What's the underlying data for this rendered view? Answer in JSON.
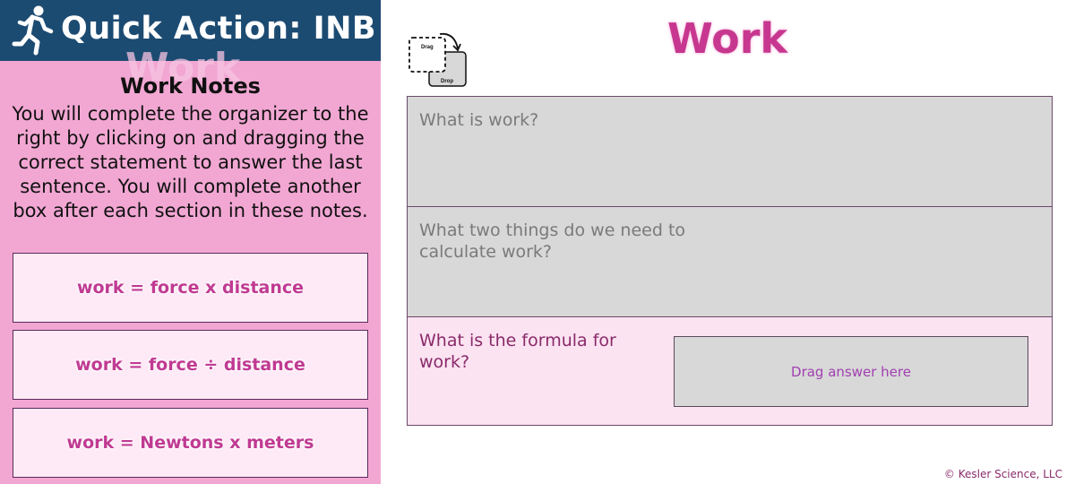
{
  "header": {
    "title": "Quick Action: INB",
    "icon": "running-person-icon"
  },
  "notes": {
    "ghost_title": "Work",
    "title": "Work Notes",
    "body": "You will complete the organizer to the right by clicking on and dragging the correct statement to answer the last sentence.  You will complete another box after each section in these notes."
  },
  "answer_cards": [
    {
      "label": "work = force x distance"
    },
    {
      "label": "work = force ÷ distance"
    },
    {
      "label": "work = Newtons x meters"
    }
  ],
  "drag_drop_icon": {
    "drag_label": "Drag",
    "drop_label": "Drop"
  },
  "page_title": "Work",
  "organizer": {
    "rows": [
      {
        "question": "What is work?"
      },
      {
        "question": "What two things do we need to calculate work?"
      },
      {
        "question": "What is the formula for work?"
      }
    ],
    "drop_zone_label": "Drag answer here"
  },
  "footer": {
    "copyright": "© Kesler Science, LLC"
  },
  "colors": {
    "header_bg": "#1c4b72",
    "panel_bg": "#f2a7d3",
    "accent_magenta": "#c7378f",
    "card_bg": "#fdeaf6",
    "question_gray_bg": "#d8d8d8",
    "answer_row_bg": "#fbe3f1"
  }
}
